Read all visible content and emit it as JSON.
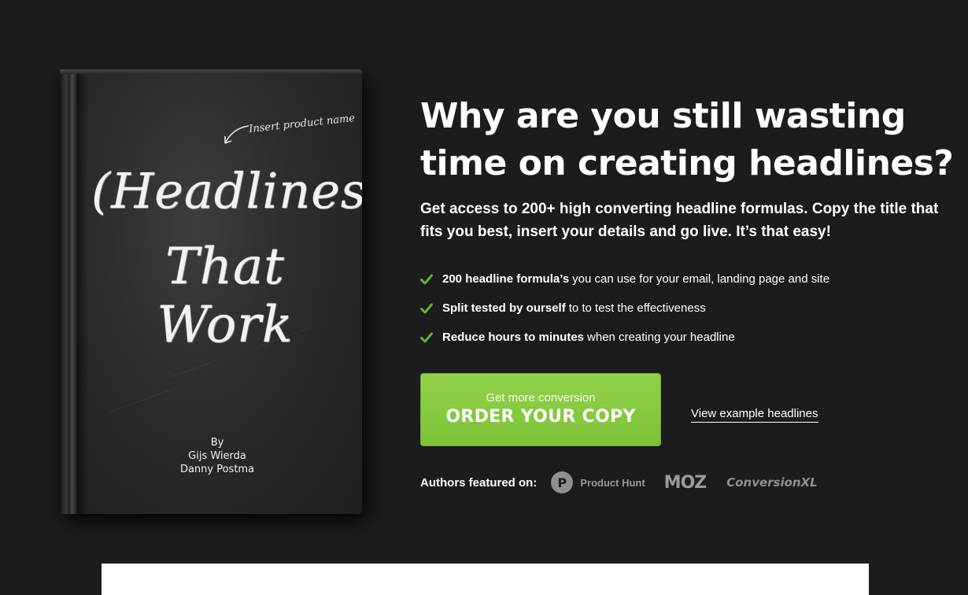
{
  "book": {
    "note": "Insert product name",
    "title_line1": "(Headlines)",
    "title_line2": "That Work",
    "by": "By",
    "author1": "Gijs Wierda",
    "author2": "Danny Postma"
  },
  "hero": {
    "headline": "Why are you still wasting time on creating headlines?",
    "subhead": "Get access to 200+ high converting headline formulas. Copy the title that fits you best, insert your details and go live. It’s that easy!",
    "features": [
      {
        "bold": "200 headline formula’s",
        "rest": "you can use for your email, landing page and site"
      },
      {
        "bold": "Split tested by ourself",
        "rest": "to to test the effectiveness"
      },
      {
        "bold": "Reduce hours to minutes",
        "rest": "when creating your headline"
      }
    ],
    "check_icon": "check-icon",
    "check_color": "#5cb531"
  },
  "cta": {
    "small": "Get more conversion",
    "big": "ORDER YOUR COPY",
    "color": "#86c941"
  },
  "link": {
    "view_examples": "View example headlines"
  },
  "featured": {
    "label": "Authors featured on:",
    "product_hunt_letter": "P",
    "product_hunt": "Product Hunt",
    "moz": "MOZ",
    "conversionxl": "ConversionXL"
  }
}
